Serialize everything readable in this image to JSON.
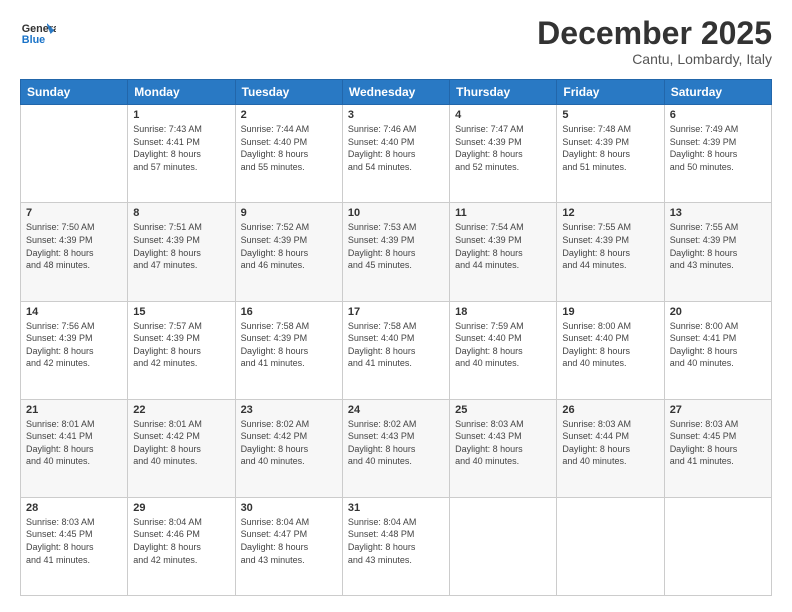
{
  "header": {
    "logo_line1": "General",
    "logo_line2": "Blue",
    "month": "December 2025",
    "location": "Cantu, Lombardy, Italy"
  },
  "weekdays": [
    "Sunday",
    "Monday",
    "Tuesday",
    "Wednesday",
    "Thursday",
    "Friday",
    "Saturday"
  ],
  "weeks": [
    [
      {
        "day": "",
        "info": ""
      },
      {
        "day": "1",
        "info": "Sunrise: 7:43 AM\nSunset: 4:41 PM\nDaylight: 8 hours\nand 57 minutes."
      },
      {
        "day": "2",
        "info": "Sunrise: 7:44 AM\nSunset: 4:40 PM\nDaylight: 8 hours\nand 55 minutes."
      },
      {
        "day": "3",
        "info": "Sunrise: 7:46 AM\nSunset: 4:40 PM\nDaylight: 8 hours\nand 54 minutes."
      },
      {
        "day": "4",
        "info": "Sunrise: 7:47 AM\nSunset: 4:39 PM\nDaylight: 8 hours\nand 52 minutes."
      },
      {
        "day": "5",
        "info": "Sunrise: 7:48 AM\nSunset: 4:39 PM\nDaylight: 8 hours\nand 51 minutes."
      },
      {
        "day": "6",
        "info": "Sunrise: 7:49 AM\nSunset: 4:39 PM\nDaylight: 8 hours\nand 50 minutes."
      }
    ],
    [
      {
        "day": "7",
        "info": "Sunrise: 7:50 AM\nSunset: 4:39 PM\nDaylight: 8 hours\nand 48 minutes."
      },
      {
        "day": "8",
        "info": "Sunrise: 7:51 AM\nSunset: 4:39 PM\nDaylight: 8 hours\nand 47 minutes."
      },
      {
        "day": "9",
        "info": "Sunrise: 7:52 AM\nSunset: 4:39 PM\nDaylight: 8 hours\nand 46 minutes."
      },
      {
        "day": "10",
        "info": "Sunrise: 7:53 AM\nSunset: 4:39 PM\nDaylight: 8 hours\nand 45 minutes."
      },
      {
        "day": "11",
        "info": "Sunrise: 7:54 AM\nSunset: 4:39 PM\nDaylight: 8 hours\nand 44 minutes."
      },
      {
        "day": "12",
        "info": "Sunrise: 7:55 AM\nSunset: 4:39 PM\nDaylight: 8 hours\nand 44 minutes."
      },
      {
        "day": "13",
        "info": "Sunrise: 7:55 AM\nSunset: 4:39 PM\nDaylight: 8 hours\nand 43 minutes."
      }
    ],
    [
      {
        "day": "14",
        "info": "Sunrise: 7:56 AM\nSunset: 4:39 PM\nDaylight: 8 hours\nand 42 minutes."
      },
      {
        "day": "15",
        "info": "Sunrise: 7:57 AM\nSunset: 4:39 PM\nDaylight: 8 hours\nand 42 minutes."
      },
      {
        "day": "16",
        "info": "Sunrise: 7:58 AM\nSunset: 4:39 PM\nDaylight: 8 hours\nand 41 minutes."
      },
      {
        "day": "17",
        "info": "Sunrise: 7:58 AM\nSunset: 4:40 PM\nDaylight: 8 hours\nand 41 minutes."
      },
      {
        "day": "18",
        "info": "Sunrise: 7:59 AM\nSunset: 4:40 PM\nDaylight: 8 hours\nand 40 minutes."
      },
      {
        "day": "19",
        "info": "Sunrise: 8:00 AM\nSunset: 4:40 PM\nDaylight: 8 hours\nand 40 minutes."
      },
      {
        "day": "20",
        "info": "Sunrise: 8:00 AM\nSunset: 4:41 PM\nDaylight: 8 hours\nand 40 minutes."
      }
    ],
    [
      {
        "day": "21",
        "info": "Sunrise: 8:01 AM\nSunset: 4:41 PM\nDaylight: 8 hours\nand 40 minutes."
      },
      {
        "day": "22",
        "info": "Sunrise: 8:01 AM\nSunset: 4:42 PM\nDaylight: 8 hours\nand 40 minutes."
      },
      {
        "day": "23",
        "info": "Sunrise: 8:02 AM\nSunset: 4:42 PM\nDaylight: 8 hours\nand 40 minutes."
      },
      {
        "day": "24",
        "info": "Sunrise: 8:02 AM\nSunset: 4:43 PM\nDaylight: 8 hours\nand 40 minutes."
      },
      {
        "day": "25",
        "info": "Sunrise: 8:03 AM\nSunset: 4:43 PM\nDaylight: 8 hours\nand 40 minutes."
      },
      {
        "day": "26",
        "info": "Sunrise: 8:03 AM\nSunset: 4:44 PM\nDaylight: 8 hours\nand 40 minutes."
      },
      {
        "day": "27",
        "info": "Sunrise: 8:03 AM\nSunset: 4:45 PM\nDaylight: 8 hours\nand 41 minutes."
      }
    ],
    [
      {
        "day": "28",
        "info": "Sunrise: 8:03 AM\nSunset: 4:45 PM\nDaylight: 8 hours\nand 41 minutes."
      },
      {
        "day": "29",
        "info": "Sunrise: 8:04 AM\nSunset: 4:46 PM\nDaylight: 8 hours\nand 42 minutes."
      },
      {
        "day": "30",
        "info": "Sunrise: 8:04 AM\nSunset: 4:47 PM\nDaylight: 8 hours\nand 43 minutes."
      },
      {
        "day": "31",
        "info": "Sunrise: 8:04 AM\nSunset: 4:48 PM\nDaylight: 8 hours\nand 43 minutes."
      },
      {
        "day": "",
        "info": ""
      },
      {
        "day": "",
        "info": ""
      },
      {
        "day": "",
        "info": ""
      }
    ]
  ]
}
